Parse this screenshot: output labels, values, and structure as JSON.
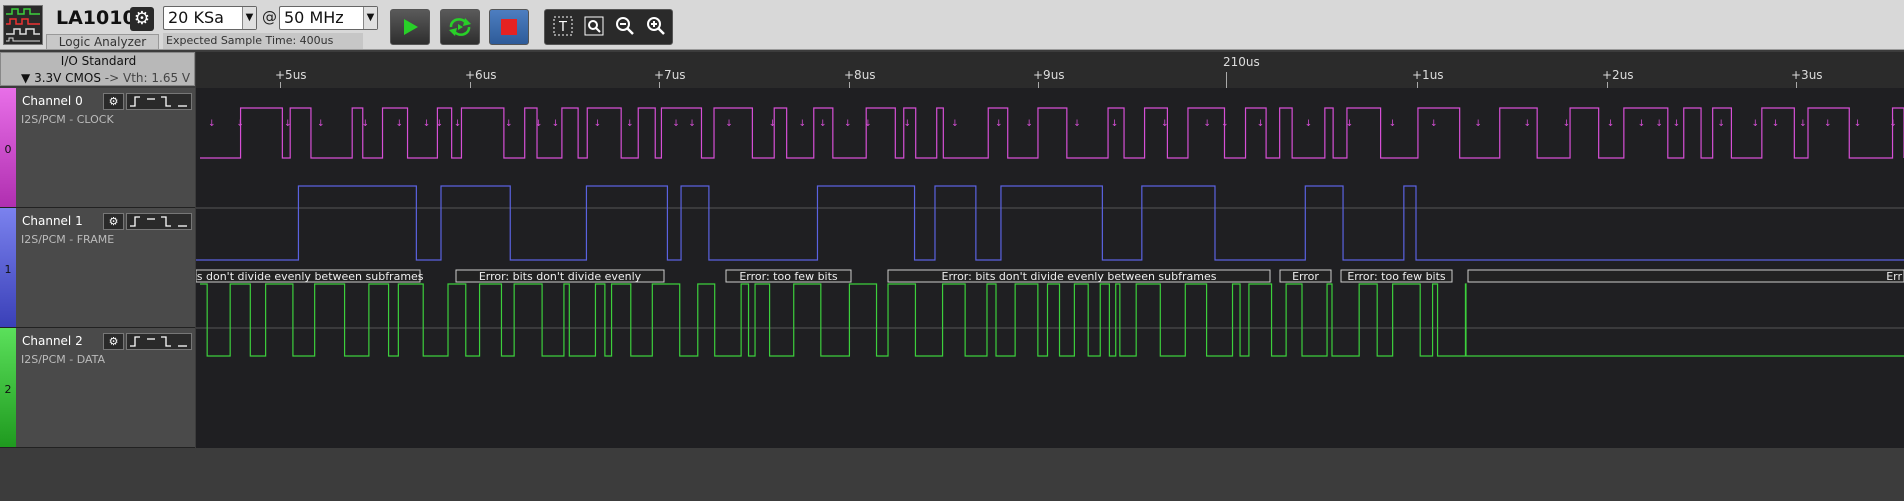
{
  "toolbar": {
    "device_name": "LA1010",
    "device_subtitle": "Logic Analyzer",
    "sample_depth": "20 KSa",
    "at_symbol": "@",
    "sample_rate": "50 MHz",
    "expected_time": "Expected Sample Time: 400us",
    "icons": [
      "logo-icon",
      "gear-icon",
      "play-icon",
      "loop-icon",
      "stop-icon",
      "text-tool-icon",
      "zoom-region-icon",
      "zoom-out-icon",
      "zoom-in-icon"
    ]
  },
  "io_standard": {
    "title": "I/O Standard",
    "value": "3.3V CMOS",
    "vth": "-> Vth: 1.65 V"
  },
  "ruler": {
    "center_label": "210us",
    "ticks": [
      "+5us",
      "+6us",
      "+7us",
      "+8us",
      "+9us",
      "+1us",
      "+2us",
      "+3us"
    ]
  },
  "channels": [
    {
      "index": "0",
      "name": "Channel 0",
      "decoder": "I2S/PCM - CLOCK",
      "color": "#d64fd6"
    },
    {
      "index": "1",
      "name": "Channel 1",
      "decoder": "I2S/PCM - FRAME",
      "color": "#5a62e0"
    },
    {
      "index": "2",
      "name": "Channel 2",
      "decoder": "I2S/PCM - DATA",
      "color": "#3ccf3c"
    }
  ],
  "decoder_labels": [
    "ts don't divide evenly between subframes",
    "Error: bits don't divide evenly",
    "Error: too few bits",
    "Error: bits don't divide evenly between subframes",
    "Error",
    "Error: too few bits",
    "Err"
  ]
}
